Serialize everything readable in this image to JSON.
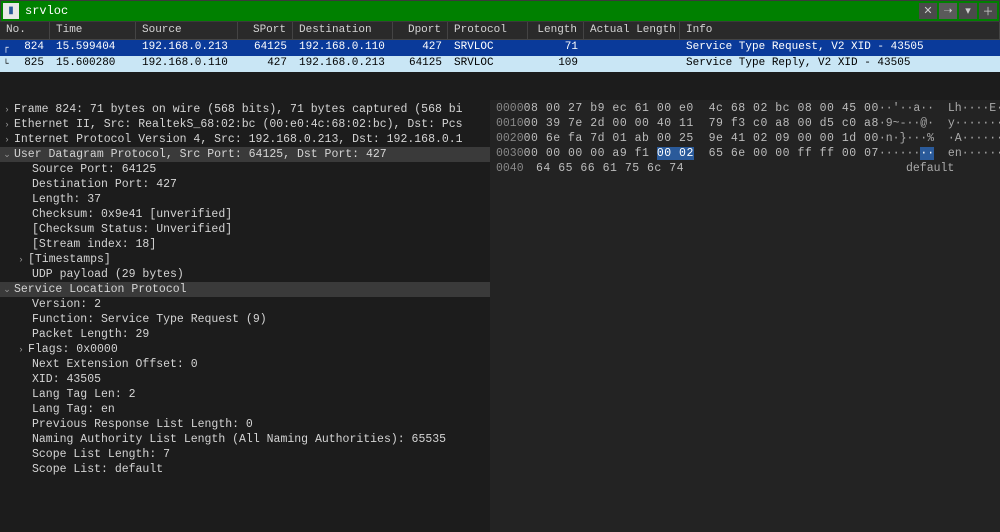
{
  "filter": {
    "value": "srvloc"
  },
  "columns": {
    "no": "No.",
    "time": "Time",
    "src": "Source",
    "sport": "SPort",
    "dst": "Destination",
    "dport": "Dport",
    "proto": "Protocol",
    "len": "Length",
    "alen": "Actual Length",
    "info": "Info"
  },
  "packets": [
    {
      "no": "824",
      "time": "15.599404",
      "src": "192.168.0.213",
      "sport": "64125",
      "dst": "192.168.0.110",
      "dport": "427",
      "proto": "SRVLOC",
      "len": "71",
      "alen": "",
      "info": "Service Type Request, V2 XID - 43505"
    },
    {
      "no": "825",
      "time": "15.600280",
      "src": "192.168.0.110",
      "sport": "427",
      "dst": "192.168.0.213",
      "dport": "64125",
      "proto": "SRVLOC",
      "len": "109",
      "alen": "",
      "info": "Service Type Reply, V2 XID - 43505"
    }
  ],
  "details": {
    "frame": "Frame 824: 71 bytes on wire (568 bits), 71 bytes captured (568 bi",
    "eth": "Ethernet II, Src: RealtekS_68:02:bc (00:e0:4c:68:02:bc), Dst: Pcs",
    "ip": "Internet Protocol Version 4, Src: 192.168.0.213, Dst: 192.168.0.1",
    "udp": "User Datagram Protocol, Src Port: 64125, Dst Port: 427",
    "udp_children": {
      "src_port": "Source Port: 64125",
      "dst_port": "Destination Port: 427",
      "length": "Length: 37",
      "checksum": "Checksum: 0x9e41 [unverified]",
      "checksum_status": "[Checksum Status: Unverified]",
      "stream": "[Stream index: 18]",
      "timestamps": "[Timestamps]",
      "payload": "UDP payload (29 bytes)"
    },
    "srvloc": "Service Location Protocol",
    "srvloc_children": {
      "version": "Version: 2",
      "function": "Function: Service Type Request (9)",
      "pktlen": "Packet Length: 29",
      "flags": "Flags: 0x0000",
      "nextext": "Next Extension Offset: 0",
      "xid": "XID: 43505",
      "langlen": "Lang Tag Len: 2",
      "langtag": "Lang Tag: en",
      "prevresp": "Previous Response List Length: 0",
      "naming": "Naming Authority List Length (All Naming Authorities): 65535",
      "scopelen": "Scope List Length: 7",
      "scopelist": "Scope List: default"
    }
  },
  "bytes": [
    {
      "offset": "0000",
      "hex": "08 00 27 b9 ec 61 00 e0  4c 68 02 bc 08 00 45 00",
      "ascii": "··'··a··  Lh····E·"
    },
    {
      "offset": "0010",
      "hex": "00 39 7e 2d 00 00 40 11  79 f3 c0 a8 00 d5 c0 a8",
      "ascii": "·9~-··@·  y·······"
    },
    {
      "offset": "0020",
      "hex": "00 6e fa 7d 01 ab 00 25  9e 41 02 09 00 00 1d 00",
      "ascii": "·n·}···%  ·A······"
    },
    {
      "offset": "0030",
      "hex_a": "00 00 00 00 a9 f1 ",
      "hex_hl": "00 02",
      "hex_b": "  65 6e 00 00 ff ff 00 07",
      "ascii_a": "······",
      "ascii_hl": "··",
      "ascii_b": "  en······"
    },
    {
      "offset": "0040",
      "hex": "64 65 66 61 75 6c 74",
      "ascii": "default"
    }
  ]
}
